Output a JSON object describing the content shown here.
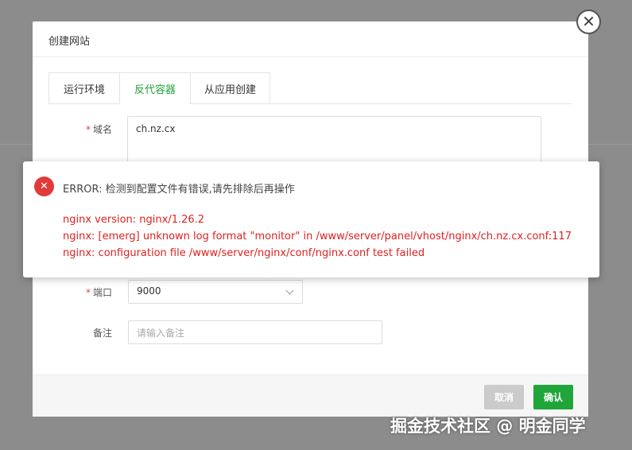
{
  "dialog": {
    "title": "创建网站",
    "close_icon": "close-icon"
  },
  "tabs": [
    {
      "label": "运行环境",
      "active": false
    },
    {
      "label": "反代容器",
      "active": true
    },
    {
      "label": "从应用创建",
      "active": false
    }
  ],
  "form": {
    "domain_label": "域名",
    "domain_value": "ch.nz.cx",
    "port_label": "端口",
    "port_value": "9000",
    "remark_label": "备注",
    "remark_placeholder": "请输入备注",
    "required_mark": "*"
  },
  "footer": {
    "cancel_label": "取消",
    "confirm_label": "确认"
  },
  "error": {
    "icon": "error-x-icon",
    "title": "ERROR: 检测到配置文件有错误,请先排除后再操作",
    "lines": [
      "nginx version: nginx/1.26.2",
      "nginx: [emerg] unknown log format \"monitor\" in /www/server/panel/vhost/nginx/ch.nz.cx.conf:117",
      "nginx: configuration file /www/server/nginx/conf/nginx.conf test failed"
    ]
  },
  "watermark": "掘金技术社区 @ 明金同学",
  "colors": {
    "accent": "#20a53a",
    "error": "#e02020",
    "overlay": "#8c8c8c"
  }
}
